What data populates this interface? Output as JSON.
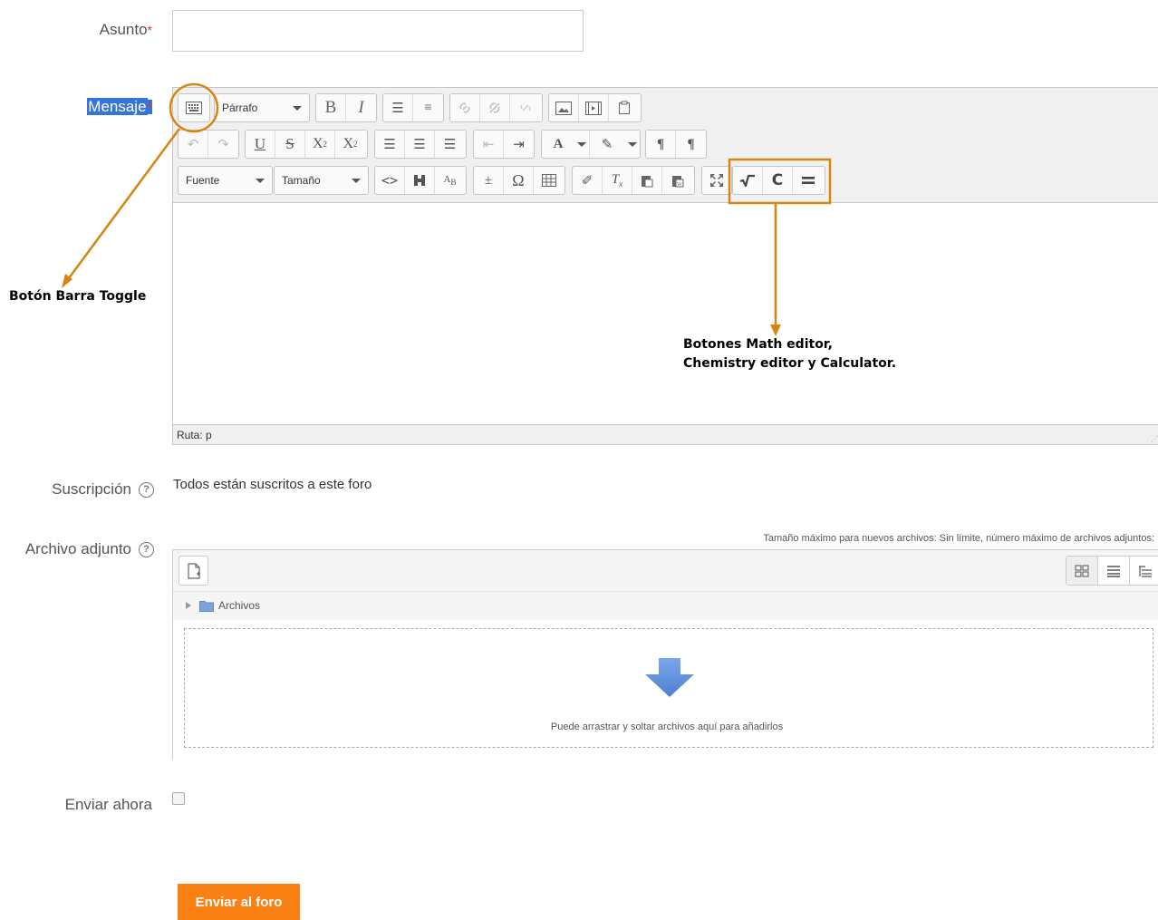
{
  "form": {
    "subject_label": "Asunto",
    "required_mark": "*",
    "subject_value": "",
    "message_label": "Mensaje",
    "subscription_label": "Suscripción",
    "subscription_value": "Todos están suscritos a este foro",
    "attachment_label": "Archivo adjunto",
    "send_now_label": "Enviar ahora",
    "submit_label": "Enviar al foro",
    "help_glyph": "?"
  },
  "editor": {
    "paragraph_select": "Párrafo",
    "font_select": "Fuente",
    "size_select": "Tamaño",
    "path_label": "Ruta: p",
    "toolbar_row1": [
      {
        "name": "toolbar-toggle-icon",
        "glyph": "▦"
      },
      {
        "name": "bold-icon",
        "glyph": "B"
      },
      {
        "name": "italic-icon",
        "glyph": "I"
      },
      {
        "name": "bullet-list-icon",
        "glyph": "☰"
      },
      {
        "name": "numbered-list-icon",
        "glyph": "≡"
      },
      {
        "name": "link-icon",
        "glyph": "🔗"
      },
      {
        "name": "unlink-icon",
        "glyph": "⛓"
      },
      {
        "name": "anchor-icon",
        "glyph": "⚓"
      },
      {
        "name": "image-icon",
        "glyph": "🖼"
      },
      {
        "name": "media-icon",
        "glyph": "🎞"
      },
      {
        "name": "paste-icon",
        "glyph": "📋"
      }
    ]
  },
  "annotations": {
    "toggle_note": "Botón Barra Toggle",
    "math_note_line1": "Botones Math editor,",
    "math_note_line2": "Chemistry editor y Calculator.",
    "accent_color": "#d58512"
  },
  "filepicker": {
    "limits_text": "Tamaño máximo para nuevos archivos: Sin límite, número máximo de archivos adjuntos:",
    "folder_label": "Archivos",
    "drop_text": "Puede arrastrar y soltar archivos aquí para añadirlos"
  },
  "colors": {
    "submit_bg": "#f98012",
    "required": "#d9362f",
    "drop_arrow": "#5b8ad6"
  }
}
